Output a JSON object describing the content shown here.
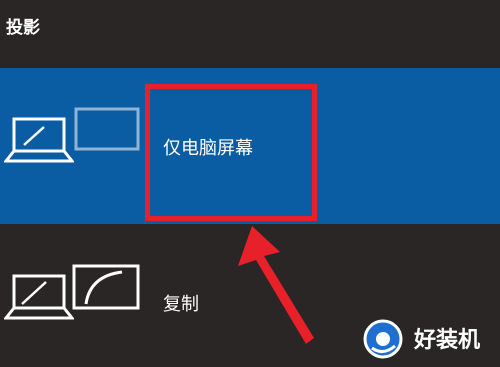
{
  "panel": {
    "title": "投影"
  },
  "options": {
    "pc_screen_only": {
      "label": "仅电脑屏幕",
      "selected": true
    },
    "duplicate": {
      "label": "复制",
      "selected": false
    }
  },
  "watermark": {
    "text": "好装机"
  },
  "colors": {
    "background": "#2a2626",
    "selected_bg": "#0a5da3",
    "annotation": "#e8202a",
    "text": "#ffffff"
  }
}
